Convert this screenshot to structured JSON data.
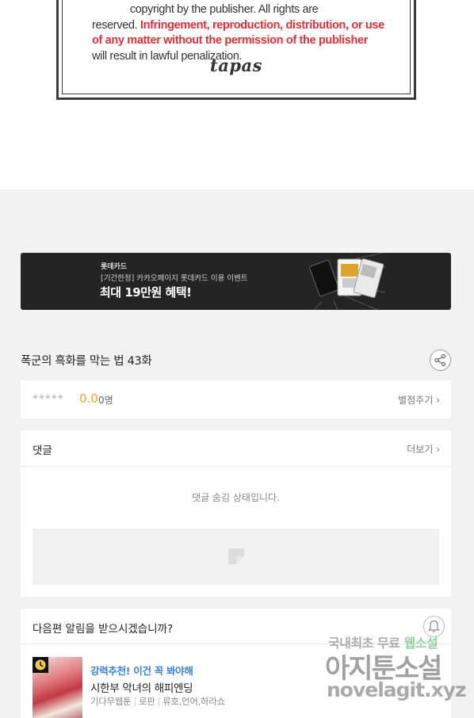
{
  "copyright": {
    "line1_partial": "             copyright by the publisher. All rights are",
    "reserved": "reserved. ",
    "red_text": "Infringement, reproduction, distribution, or use of any matter without the permission of the publisher",
    "rest": " will result in lawful penalization.",
    "brand": "tapas"
  },
  "banner": {
    "brand": "롯데카드",
    "subtitle": "[기간한정] 카카오페이지 롯데카드 이용 이벤트",
    "title": "최대 19만원 혜택!"
  },
  "episode": {
    "title": "폭군의 흑화를 막는 법 43화"
  },
  "rating": {
    "stars": "★★★★★",
    "score": "0.0",
    "count": "0명",
    "rate_label": "별점주기 ›"
  },
  "comments": {
    "title": "댓글",
    "more": "더보기 ›",
    "hidden_text": "댓글 숨김 상태입니다."
  },
  "notify": {
    "title": "다음편 알림을 받으시겠습니까?",
    "recommend": "강력추천! 이건 꼭 봐야해",
    "work_title": "시한부 악녀의 해피엔딩",
    "meta": [
      "기다무웹툰",
      "로판",
      "류호,언어,하라쇼"
    ]
  },
  "watermark": {
    "line1_a": "국내최초 무료 ",
    "line1_b": "웹소설",
    "line2": "아지툰소설",
    "line3": "novelagit.xyz"
  },
  "colors": {
    "accent_red": "#e0303b",
    "score_yellow": "#e8a72a",
    "recommend_blue": "#3b82d6",
    "banner_bg": "#242424"
  }
}
